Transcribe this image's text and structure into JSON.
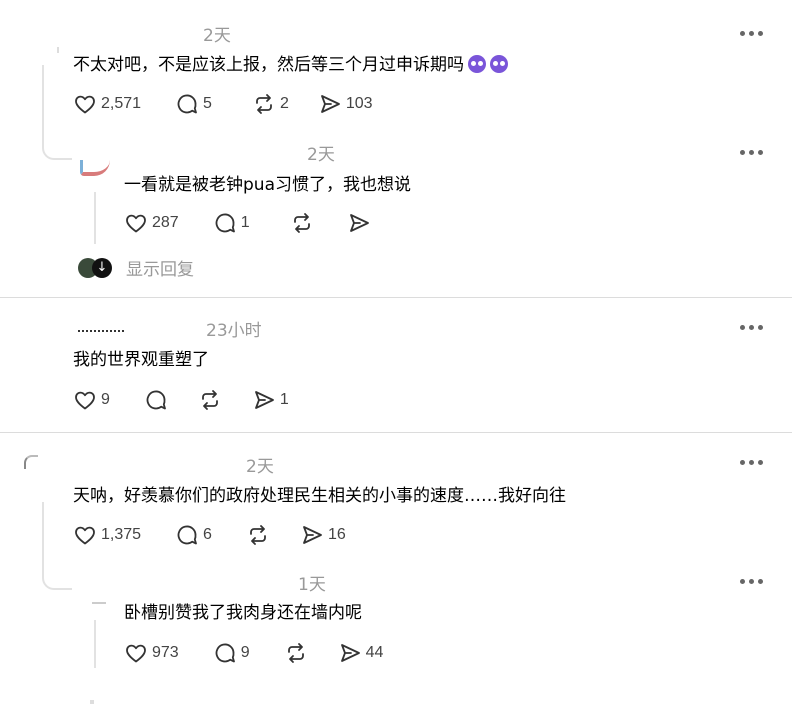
{
  "comments": [
    {
      "time": "2天",
      "text": "不太对吧，不是应该上报，然后等三个月过申诉期吗",
      "emojis": [
        "crying-face-emoji",
        "crying-face-emoji"
      ],
      "likes": "2,571",
      "replies": "5",
      "reposts": "2",
      "shares": "103"
    },
    {
      "time": "2天",
      "text": "一看就是被老钟pua习惯了，我也想说",
      "likes": "287",
      "replies": "1",
      "reposts": "",
      "shares": "",
      "show_replies_label": "显示回复"
    },
    {
      "time": "23小时",
      "text": "我的世界观重塑了",
      "likes": "9",
      "replies": "",
      "reposts": "",
      "shares": "1"
    },
    {
      "time": "2天",
      "text": "天呐，好羡慕你们的政府处理民生相关的小事的速度……我好向往",
      "likes": "1,375",
      "replies": "6",
      "reposts": "",
      "shares": "16"
    },
    {
      "time": "1天",
      "text": "卧槽别赞我了我肉身还在墙内呢",
      "likes": "973",
      "replies": "9",
      "reposts": "",
      "shares": "44"
    }
  ],
  "icons": {
    "like": "heart-icon",
    "reply": "comment-bubble-icon",
    "repost": "repost-arrows-icon",
    "share": "send-paper-plane-icon",
    "more": "more-dots-icon"
  },
  "colors": {
    "text": "#000000",
    "muted": "#999999",
    "icon": "#444444",
    "divider": "#dcdcdc",
    "emoji": "#7a55d9"
  }
}
